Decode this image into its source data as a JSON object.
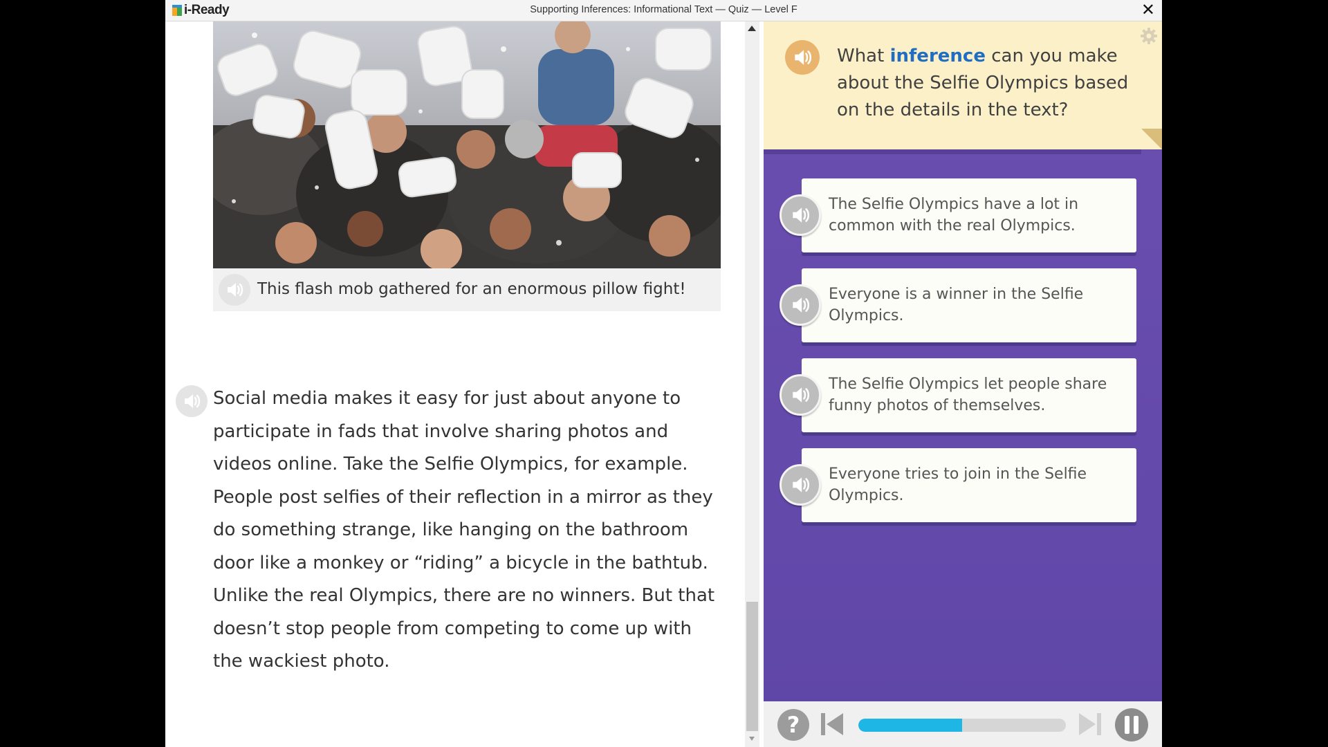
{
  "app": {
    "logo_text": "i-Ready",
    "window_title": "Supporting Inferences: Informational Text  — Quiz — Level F",
    "close_symbol": "✕"
  },
  "passage": {
    "photo_icon": "pillow-fight-crowd-photo",
    "caption": "This flash mob gathered for an enormous pillow fight!",
    "paragraph": "Social media makes it easy for just about anyone to participate in fads that involve sharing photos and videos online. Take the Selfie Olympics, for example. People post selfies of their reflection in a mirror as they do something strange, like hanging on the bathroom door like a monkey or “riding” a bicycle in the bathtub. Unlike the real Olympics, there are no winners. But that doesn’t stop people from competing to come up with the wackiest photo."
  },
  "question": {
    "text_before": "What ",
    "highlight": "inference",
    "text_after": " can you make about the Selfie Olympics based on the details in the text?"
  },
  "answers": [
    {
      "text": "The Selfie Olympics have a lot in common with the real Olympics."
    },
    {
      "text": "Everyone is a winner in the Selfie Olympics."
    },
    {
      "text": "The Selfie Olympics let people share funny photos of themselves."
    },
    {
      "text": "Everyone tries to join in the Selfie Olympics."
    }
  ],
  "toolbar": {
    "help_label": "?",
    "progress_fraction": 0.5
  },
  "colors": {
    "panel_purple": "#6c4fb0",
    "question_bg": "#fcf0c8",
    "highlight_blue": "#1f6ec4",
    "speaker_orange": "#e9b56e",
    "progress_cyan": "#1eb6e4"
  },
  "icons": [
    "speaker-icon",
    "gear-icon",
    "help-icon",
    "previous-icon",
    "next-icon",
    "pause-icon",
    "close-icon"
  ]
}
